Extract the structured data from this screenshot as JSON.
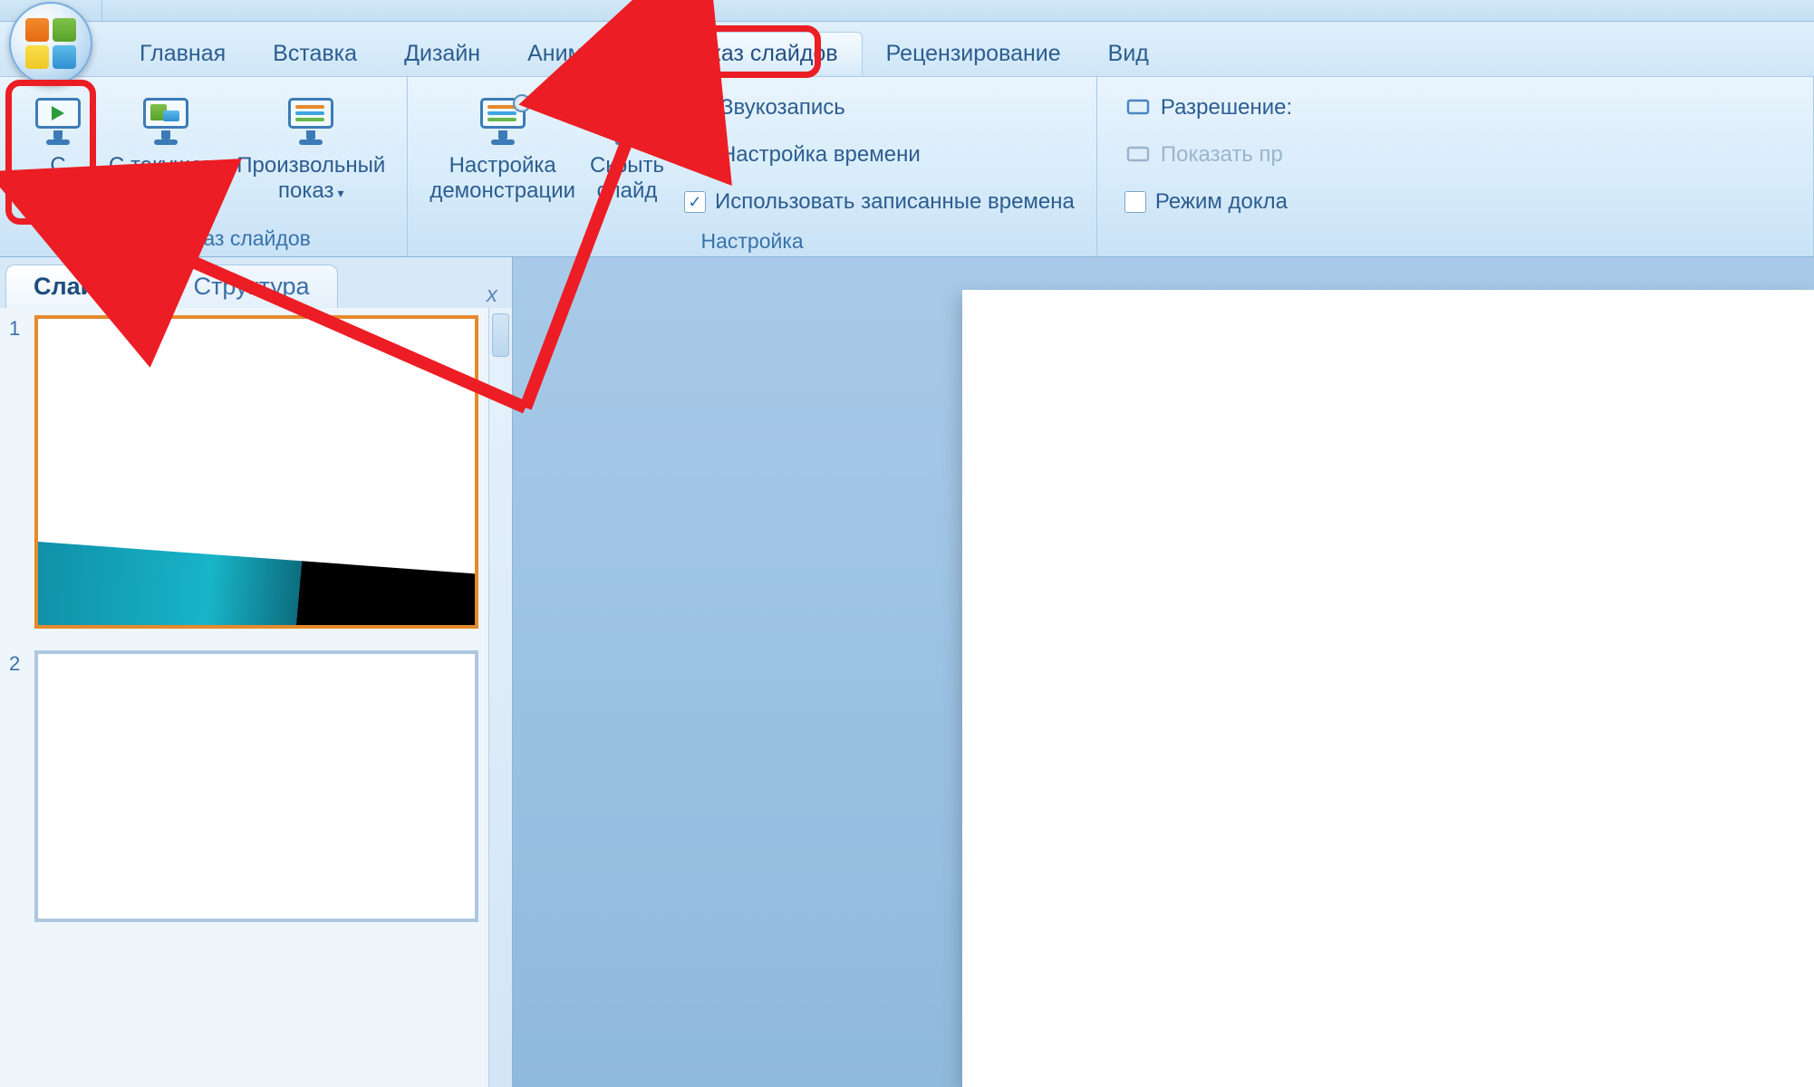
{
  "tabs": {
    "items": [
      "Главная",
      "Вставка",
      "Дизайн",
      "Анимация",
      "Показ слайдов",
      "Рецензирование",
      "Вид"
    ],
    "active_index": 4
  },
  "ribbon": {
    "group_start": {
      "title": "Начать показ слайдов",
      "from_beginning": "С\nначала",
      "from_current": "С текущего\nслайда",
      "custom": "Произвольный\nпоказ"
    },
    "group_setup": {
      "title": "Настройка",
      "setup_show": "Настройка\nдемонстрации",
      "hide_slide": "Скрыть\nслайд",
      "record": "Звукозапись",
      "rehearse": "Настройка времени",
      "use_timings": "Использовать записанные времена",
      "use_timings_checked": true
    },
    "group_monitors": {
      "resolution": "Разрешение:",
      "show_on": "Показать пр",
      "presenter": "Режим докла",
      "presenter_checked": false
    }
  },
  "pane": {
    "tab_slides": "Слайды",
    "tab_outline": "Структура",
    "close_glyph": "x"
  },
  "thumbnails": [
    {
      "num": "1",
      "highlighted": true,
      "wave": true
    },
    {
      "num": "2",
      "highlighted": false,
      "wave": false
    }
  ]
}
